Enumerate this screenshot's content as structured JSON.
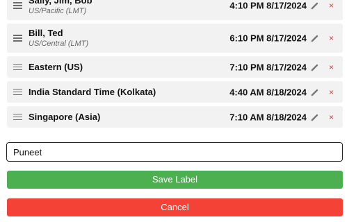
{
  "clocks": [
    {
      "name": "Sally, Jim, Bob",
      "timezone": "US/Pacific (LMT)",
      "time": "4:10 PM 8/17/2024"
    },
    {
      "name": "Bill, Ted",
      "timezone": "US/Central (LMT)",
      "time": "6:10 PM 8/17/2024"
    },
    {
      "name": "Eastern (US)",
      "timezone": "",
      "time": "7:10 PM 8/17/2024"
    },
    {
      "name": "India Standard Time (Kolkata)",
      "timezone": "",
      "time": "4:40 AM 8/18/2024"
    },
    {
      "name": "Singapore (Asia)",
      "timezone": "",
      "time": "7:10 AM 8/18/2024"
    }
  ],
  "icons": {
    "handle": "drag-handle-icon",
    "edit": "pencil-icon",
    "delete": "close-icon",
    "delete_glyph": "×"
  },
  "form": {
    "label_value": "Puneet",
    "save_label": "Save Label",
    "cancel_label": "Cancel"
  },
  "colors": {
    "row_background": "#f2f2f2",
    "save": "#4caf50",
    "cancel": "#f44336",
    "delete_icon": "#e53935"
  }
}
